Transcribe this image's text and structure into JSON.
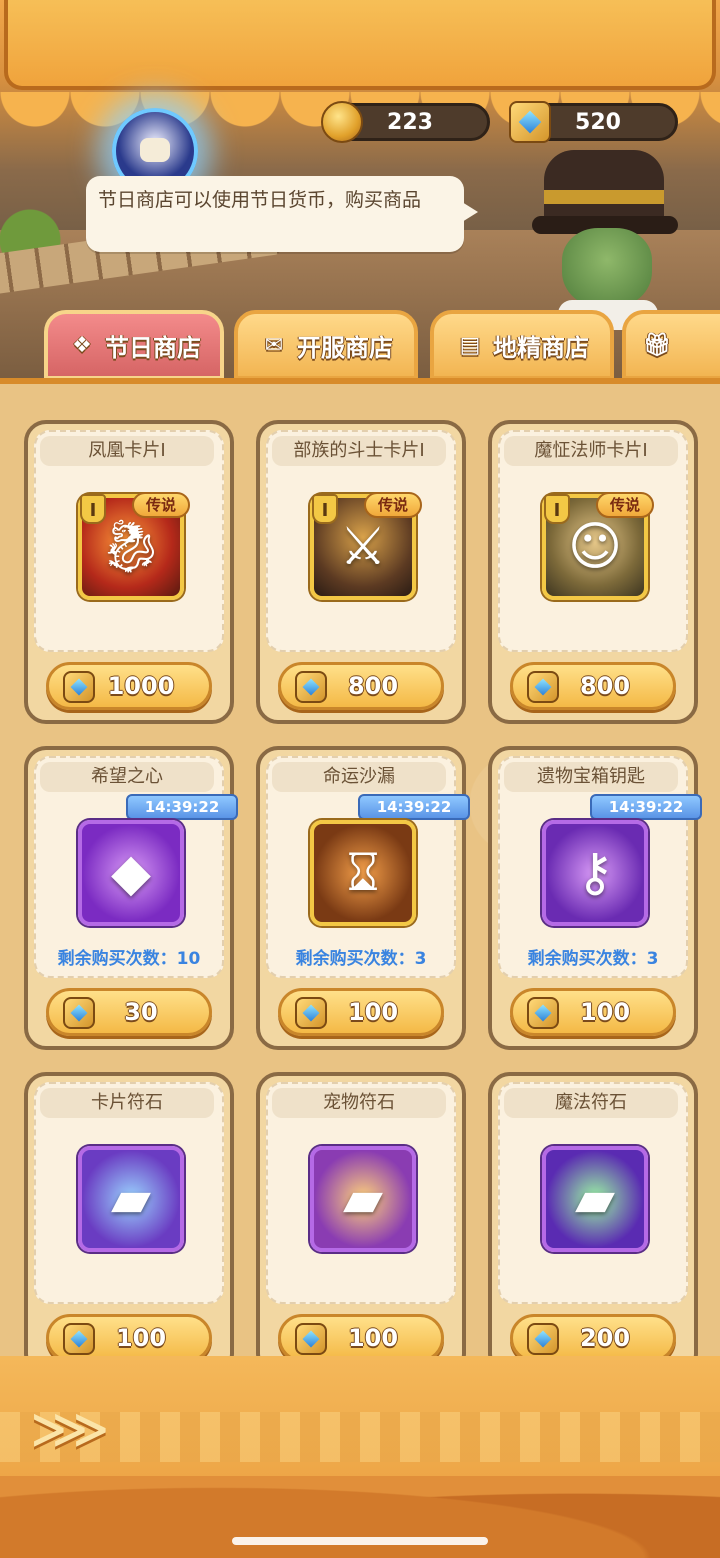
{
  "currency": {
    "coins": "223",
    "gems": "520"
  },
  "npc": {
    "speech": "节日商店可以使用节日货币，购买商品"
  },
  "tabs": [
    {
      "label": "节日商店",
      "icon": "festival-icon",
      "active": true
    },
    {
      "label": "开服商店",
      "icon": "ticket-icon",
      "active": false
    },
    {
      "label": "地精商店",
      "icon": "shop-icon",
      "active": false
    },
    {
      "label": "",
      "icon": "gift-icon",
      "active": false
    }
  ],
  "shop": {
    "items": [
      {
        "title": "凤凰卡片Ⅰ",
        "level": "I",
        "rarity": "传说",
        "price": "1000",
        "icon": "phoenix-card-icon"
      },
      {
        "title": "部族的斗士卡片Ⅰ",
        "level": "I",
        "rarity": "传说",
        "price": "800",
        "icon": "orc-warrior-card-icon"
      },
      {
        "title": "魔怔法师卡片Ⅰ",
        "level": "I",
        "rarity": "传说",
        "price": "800",
        "icon": "goblin-mage-card-icon"
      },
      {
        "title": "希望之心",
        "timer": "14:39:22",
        "remaining": "剩余购买次数：10",
        "price": "30",
        "icon": "crystal-icon"
      },
      {
        "title": "命运沙漏",
        "timer": "14:39:22",
        "remaining": "剩余购买次数：3",
        "price": "100",
        "icon": "hourglass-icon"
      },
      {
        "title": "遗物宝箱钥匙",
        "timer": "14:39:22",
        "remaining": "剩余购买次数：3",
        "price": "100",
        "icon": "key-icon"
      },
      {
        "title": "卡片符石",
        "price": "100",
        "icon": "card-rune-icon"
      },
      {
        "title": "宠物符石",
        "price": "100",
        "icon": "pet-rune-icon"
      },
      {
        "title": "魔法符石",
        "price": "200",
        "icon": "magic-rune-icon"
      }
    ]
  }
}
